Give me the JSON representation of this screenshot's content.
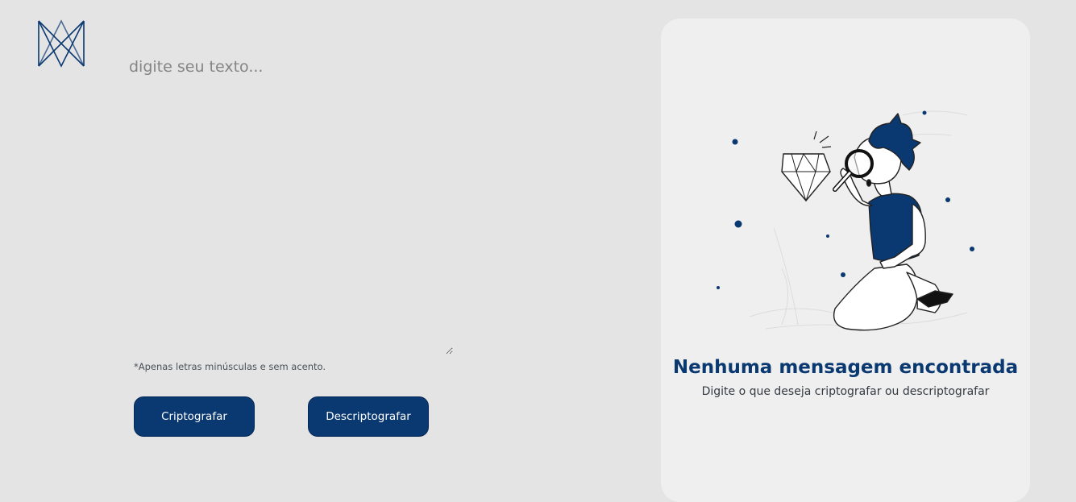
{
  "logo": {
    "icon": "alura-logo-icon"
  },
  "editor": {
    "value": "",
    "placeholder": "digite seu texto..."
  },
  "hint": "*Apenas letras minúsculas e sem acento.",
  "buttons": {
    "encrypt_label": "Criptografar",
    "decrypt_label": "Descriptografar"
  },
  "output": {
    "title": "Nenhuma mensagem encontrada",
    "subtitle": "Digite o que deseja criptografar ou descriptografar",
    "illustration": "boy-with-magnifying-glass-illustration"
  },
  "colors": {
    "background": "#e4e4e5",
    "primary": "#0a3871",
    "panel": "#efefef",
    "placeholder": "#858585"
  }
}
